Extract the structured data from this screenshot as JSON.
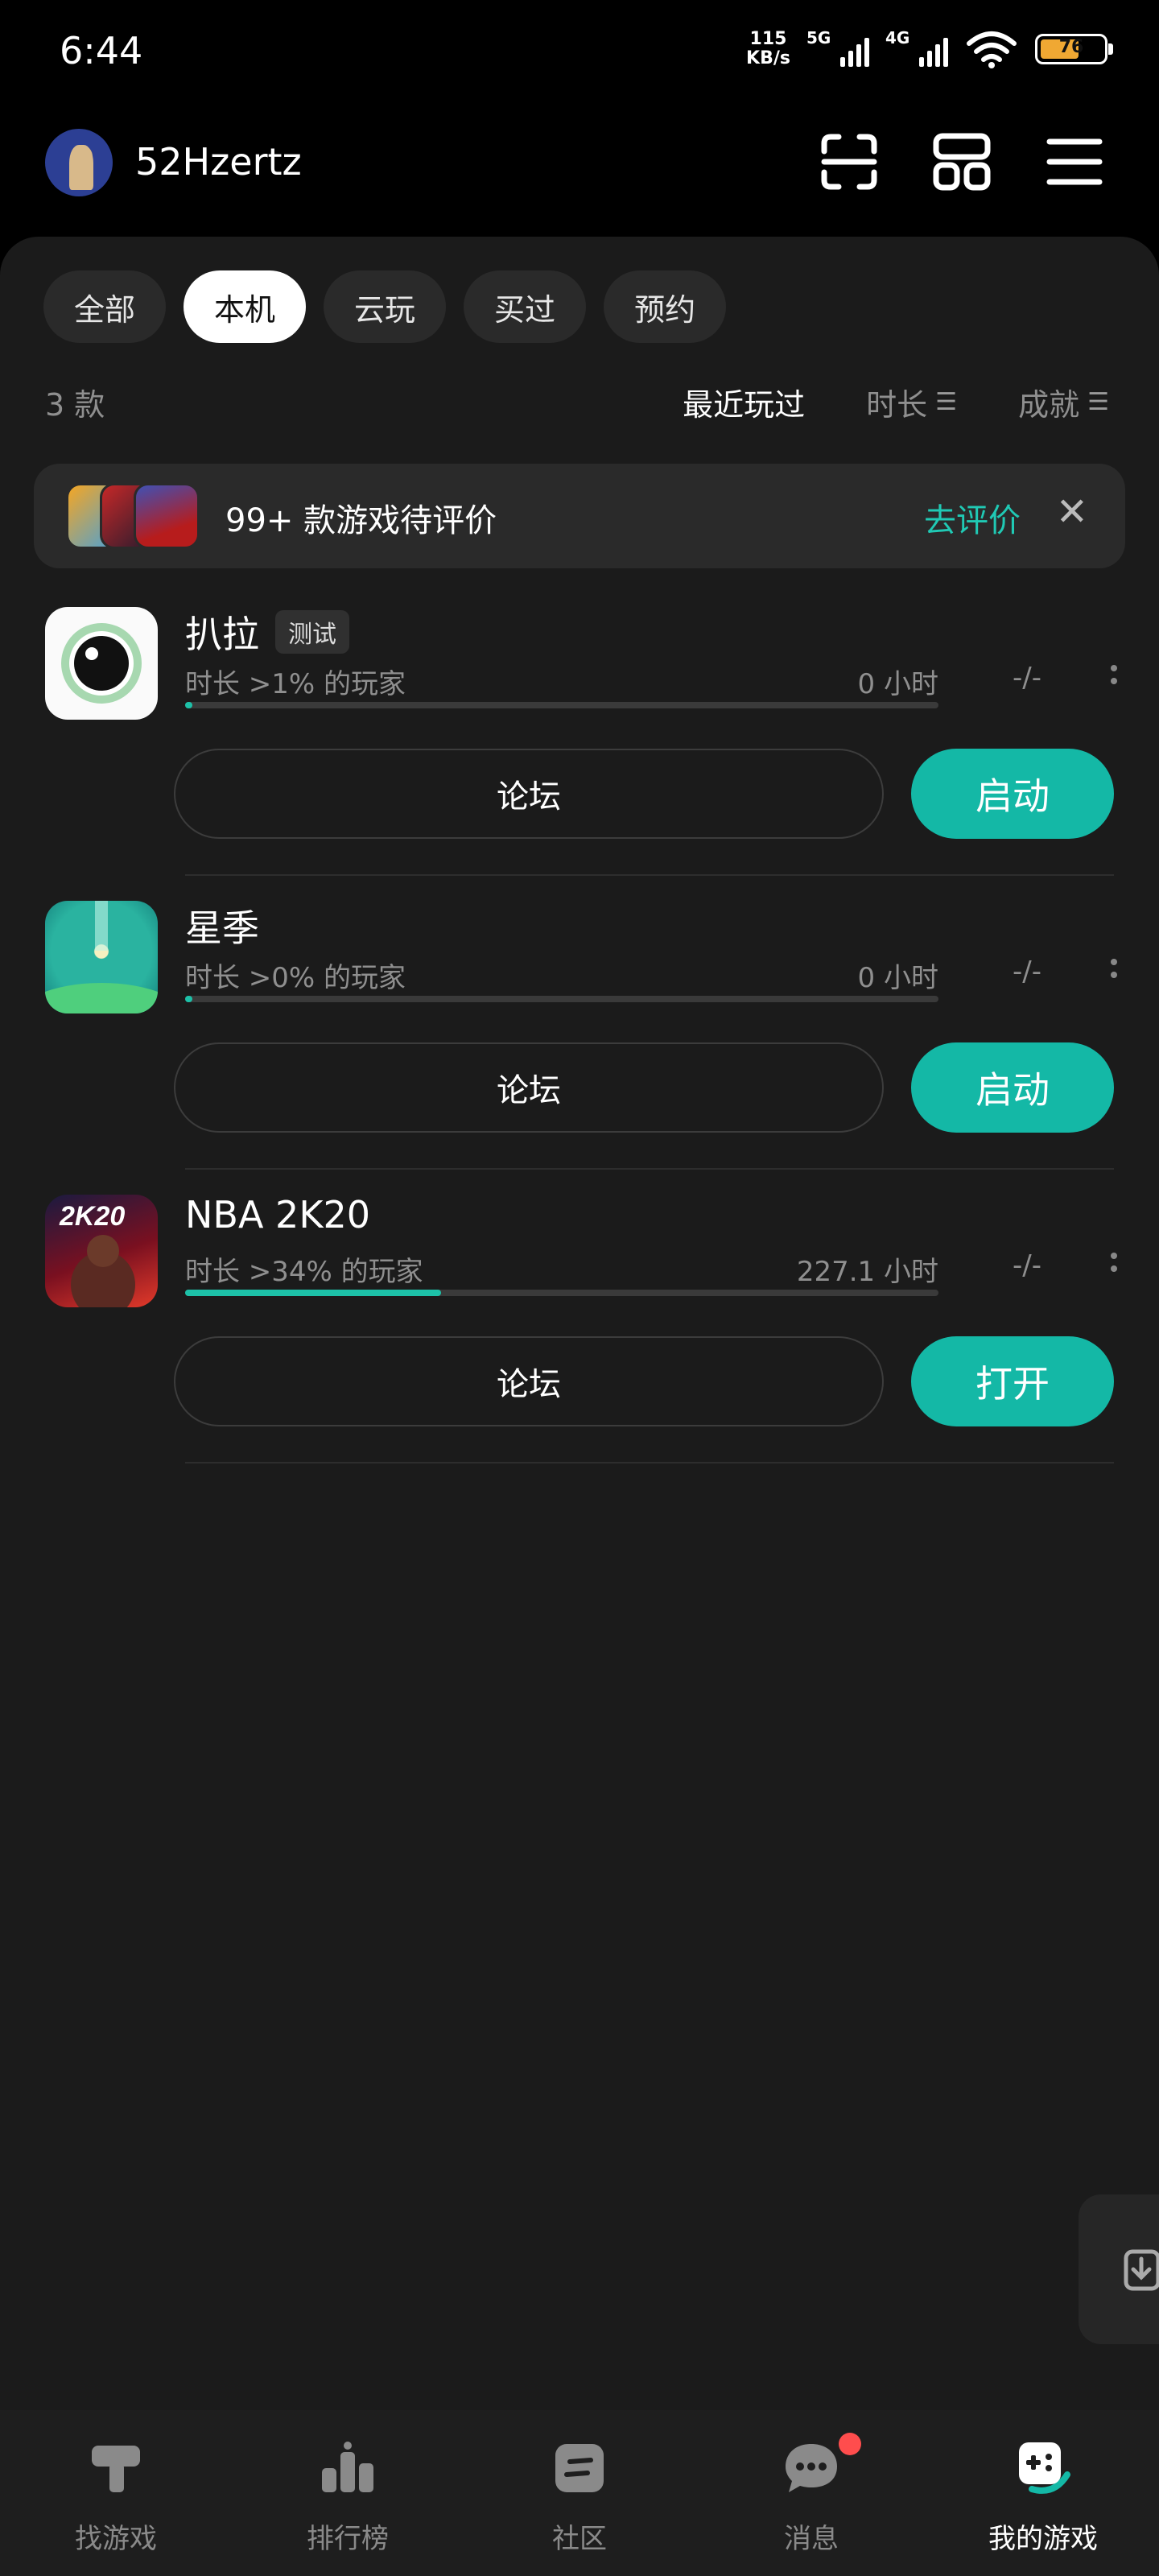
{
  "status_bar": {
    "time": "6:44",
    "net_speed_value": "115",
    "net_speed_unit": "KB/s",
    "sig1_label": "5G",
    "sig2_label": "4G",
    "battery": "76"
  },
  "header": {
    "username": "52Hzertz"
  },
  "filters": [
    "全部",
    "本机",
    "云玩",
    "买过",
    "预约"
  ],
  "active_filter": 1,
  "list_meta": {
    "count": "3 款",
    "sort_recent": "最近玩过",
    "sort_duration": "时长",
    "sort_achievement": "成就"
  },
  "banner": {
    "text": "99+ 款游戏待评价",
    "action": "去评价"
  },
  "games": [
    {
      "name": "扒拉",
      "tag": "测试",
      "subtitle": "时长 >1% 的玩家",
      "hours": "0 小时",
      "score": "-/-",
      "progress": 0.01,
      "forum_label": "论坛",
      "primary_label": "启动"
    },
    {
      "name": "星季",
      "tag": "",
      "subtitle": "时长 >0% 的玩家",
      "hours": "0 小时",
      "score": "-/-",
      "progress": 0.01,
      "forum_label": "论坛",
      "primary_label": "启动"
    },
    {
      "name": "NBA 2K20",
      "tag": "",
      "subtitle": "时长 >34% 的玩家",
      "hours": "227.1 小时",
      "score": "-/-",
      "progress": 0.34,
      "forum_label": "论坛",
      "primary_label": "打开"
    }
  ],
  "bottom_nav": [
    {
      "label": "找游戏",
      "icon": "hammer-icon"
    },
    {
      "label": "排行榜",
      "icon": "podium-icon"
    },
    {
      "label": "社区",
      "icon": "community-icon"
    },
    {
      "label": "消息",
      "icon": "message-icon"
    },
    {
      "label": "我的游戏",
      "icon": "gamepad-icon"
    }
  ],
  "colors": {
    "accent": "#14b8a6",
    "background": "#1b1b1b",
    "badge": "#ff4d4d"
  }
}
